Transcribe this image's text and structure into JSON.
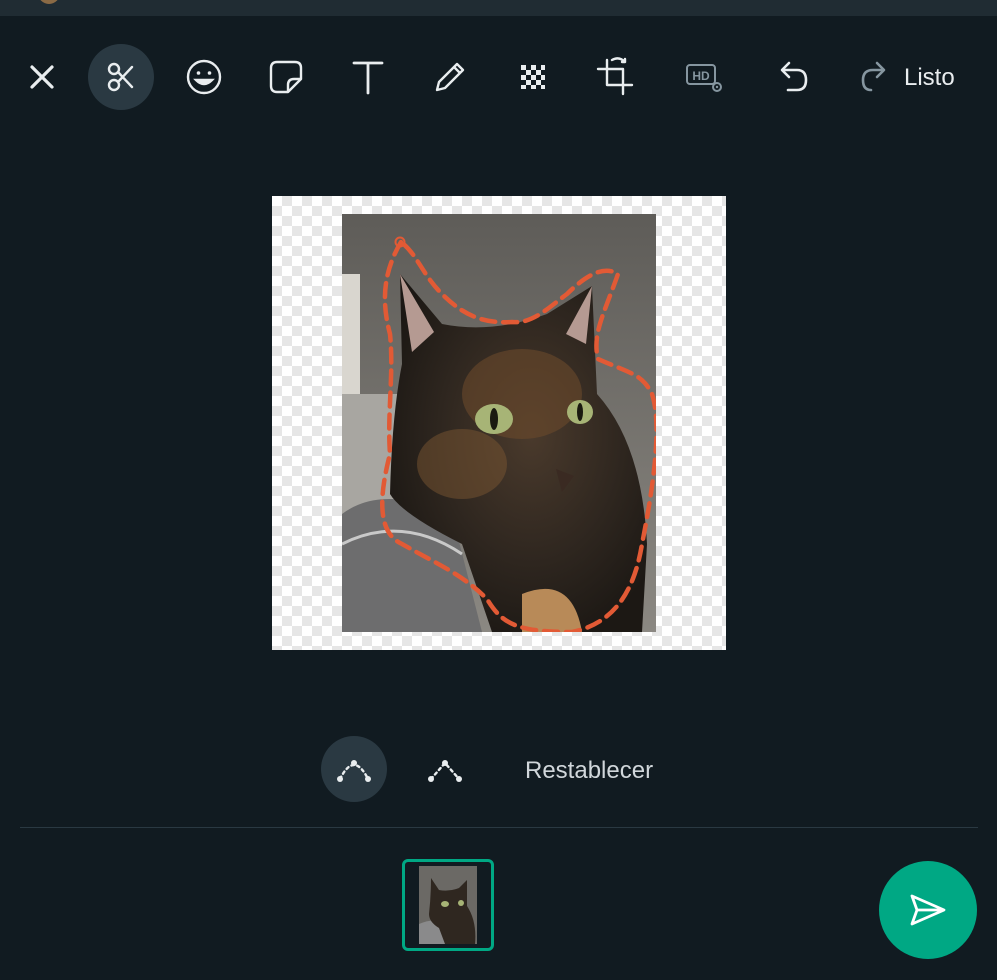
{
  "toolbar": {
    "tools": [
      "close-icon",
      "scissors-icon",
      "emoji-icon",
      "sticker-icon",
      "text-icon",
      "pencil-icon",
      "blur-checker-icon",
      "crop-icon",
      "hd-settings-icon",
      "undo-icon",
      "redo-icon"
    ],
    "active_tool": "scissors-icon",
    "done_label": "Listo"
  },
  "editor": {
    "image": "tortoiseshell cat photo with dashed cutout outline",
    "outline_color": "#e25a35"
  },
  "cut_modes": {
    "smooth_icon": "curve-points-icon",
    "polygon_icon": "polygon-points-icon",
    "active": "smooth",
    "reset_label": "Restablecer"
  },
  "footer": {
    "thumbnail": "cat thumbnail",
    "send_icon": "send-icon"
  },
  "colors": {
    "background": "#111b21",
    "surface": "#2a3942",
    "accent": "#00a884",
    "text": "#e9edef"
  }
}
